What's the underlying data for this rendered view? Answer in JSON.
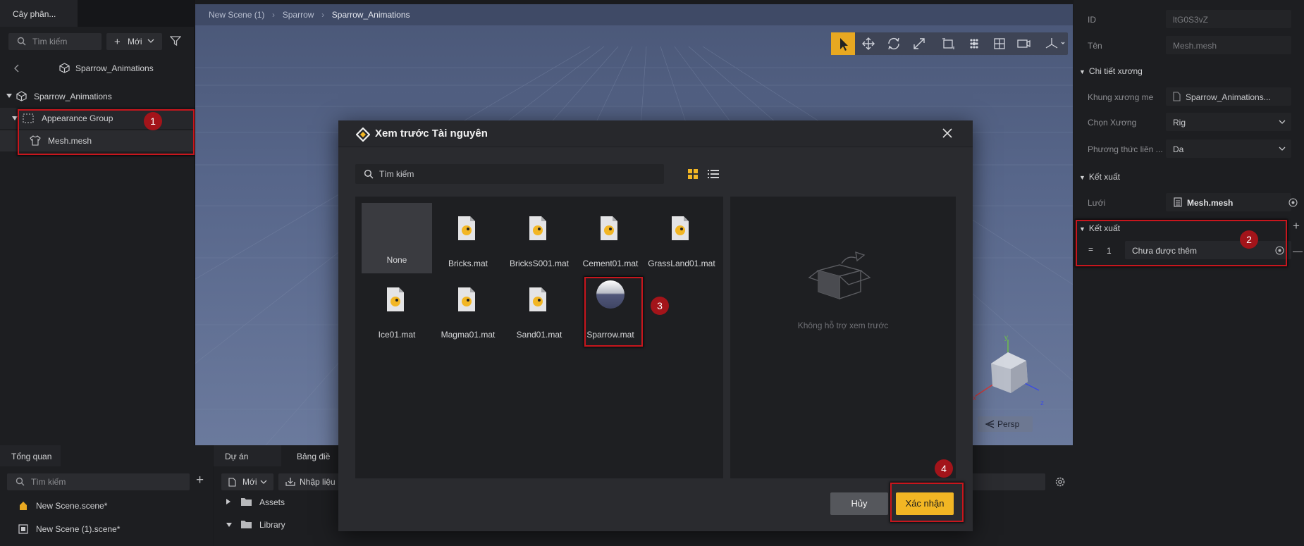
{
  "hierarchy": {
    "tab_label": "Cây phân...",
    "search_placeholder": "Tìm kiếm",
    "new_button": "Mới",
    "back_root": "Sparrow_Animations",
    "tree": {
      "root": "Sparrow_Animations",
      "group": "Appearance Group",
      "mesh": "Mesh.mesh"
    }
  },
  "viewport": {
    "breadcrumb": [
      "New Scene (1)",
      "Sparrow",
      "Sparrow_Animations"
    ],
    "persp_label": "Persp",
    "axes": {
      "x": "x",
      "y": "y",
      "z": "z"
    }
  },
  "inspector": {
    "id_label": "ID",
    "id_value": "ltG0S3vZ",
    "name_label": "Tên",
    "name_value": "Mesh.mesh",
    "skeleton_section": "Chi tiết xương",
    "parent_skeleton_label": "Khung xương me",
    "parent_skeleton_value": "Sparrow_Animations...",
    "choose_bone_label": "Chọn Xương",
    "choose_bone_value": "Rig",
    "link_method_label": "Phương thức liên ...",
    "link_method_value": "Da",
    "render_section": "Kết xuất",
    "mesh_label": "Lưới",
    "mesh_value": "Mesh.mesh",
    "render_section2": "Kết xuất",
    "material_index": "1",
    "material_value": "Chưa được thêm"
  },
  "overview": {
    "tab_label": "Tổng quan",
    "search_placeholder": "Tìm kiếm",
    "scenes": [
      "New Scene.scene*",
      "New Scene (1).scene*"
    ]
  },
  "project": {
    "tabs": [
      "Dự án",
      "Bảng điề"
    ],
    "new_button": "Mới",
    "import_button": "Nhập liệu",
    "folders": [
      "Assets",
      "Library"
    ]
  },
  "modal": {
    "title": "Xem trước Tài nguyên",
    "search_placeholder": "Tìm kiếm",
    "assets": [
      {
        "name": "None",
        "icon": "none"
      },
      {
        "name": "Bricks.mat",
        "icon": "material-file-icon"
      },
      {
        "name": "BricksS001.mat",
        "icon": "material-file-icon"
      },
      {
        "name": "Cement01.mat",
        "icon": "material-file-icon"
      },
      {
        "name": "GrassLand01.mat",
        "icon": "material-file-icon"
      },
      {
        "name": "Ice01.mat",
        "icon": "material-file-icon"
      },
      {
        "name": "Magma01.mat",
        "icon": "material-file-icon"
      },
      {
        "name": "Sand01.mat",
        "icon": "material-file-icon"
      },
      {
        "name": "Sparrow.mat",
        "icon": "material-sphere-icon"
      }
    ],
    "preview_empty": "Không hỗ trợ xem trước",
    "cancel": "Hủy",
    "confirm": "Xác nhận"
  },
  "annotations": [
    "1",
    "2",
    "3",
    "4"
  ],
  "colors": {
    "accent": "#f2b624",
    "highlight": "#c8161d",
    "badge": "#a3141a"
  }
}
